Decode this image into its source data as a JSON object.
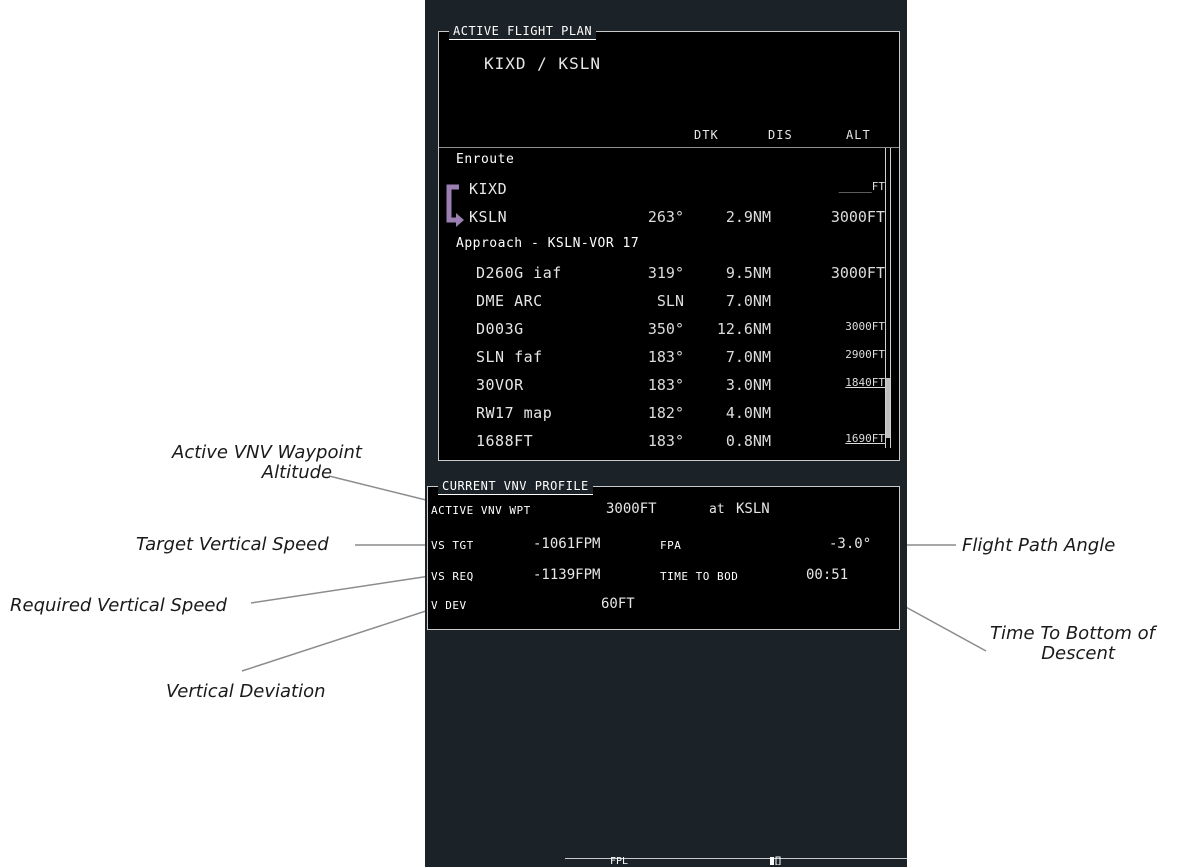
{
  "flight_plan": {
    "title": "ACTIVE FLIGHT PLAN",
    "route": "KIXD / KSLN",
    "columns": {
      "dtk": "DTK",
      "dis": "DIS",
      "alt": "ALT"
    },
    "sections": [
      {
        "label": "Enroute"
      },
      {
        "label": "Approach - KSLN-VOR 17"
      }
    ],
    "rows": [
      {
        "name": "KIXD",
        "dtk": "",
        "dis": "",
        "alt": "_____FT"
      },
      {
        "name": "KSLN",
        "dtk": "263°",
        "dis": "2.9NM",
        "alt": "3000FT"
      },
      {
        "name": "D260G iaf",
        "dtk": "319°",
        "dis": "9.5NM",
        "alt": "3000FT"
      },
      {
        "name": "DME ARC",
        "dtk": "SLN",
        "dis": "7.0NM",
        "alt": ""
      },
      {
        "name": "D003G",
        "dtk": "350°",
        "dis": "12.6NM",
        "alt": "3000FT"
      },
      {
        "name": "SLN faf",
        "dtk": "183°",
        "dis": "7.0NM",
        "alt": "2900FT"
      },
      {
        "name": "30VOR",
        "dtk": "183°",
        "dis": "3.0NM",
        "alt": "1840FT"
      },
      {
        "name": "RW17 map",
        "dtk": "182°",
        "dis": "4.0NM",
        "alt": ""
      },
      {
        "name": "1688FT",
        "dtk": "183°",
        "dis": "0.8NM",
        "alt": "1690FT"
      }
    ]
  },
  "vnv_profile": {
    "title": "CURRENT VNV PROFILE",
    "active_wpt_label": "ACTIVE VNV WPT",
    "active_wpt_alt": "3000FT",
    "at_label": "at",
    "active_wpt_name": "KSLN",
    "vs_tgt_label": "VS TGT",
    "vs_tgt_value": "-1061FPM",
    "fpa_label": "FPA",
    "fpa_value": "-3.0°",
    "vs_req_label": "VS REQ",
    "vs_req_value": "-1139FPM",
    "time_bod_label": "TIME TO BOD",
    "time_bod_value": "00:51",
    "vdev_label": "V DEV",
    "vdev_value": "60FT"
  },
  "callouts": {
    "active_vnv_alt": [
      "Active VNV Waypoint",
      "Altitude"
    ],
    "target_vs": "Target Vertical Speed",
    "required_vs": "Required Vertical Speed",
    "vertical_deviation": "Vertical Deviation",
    "fpa": "Flight Path Angle",
    "time_bod": [
      "Time To Bottom of",
      "Descent"
    ]
  },
  "softkeys": {
    "fpl": "FPL"
  },
  "colors": {
    "screen_bg": "#1c2328",
    "active_leg_arrow": "#9b7fb3",
    "text": "#e6e6e6"
  }
}
